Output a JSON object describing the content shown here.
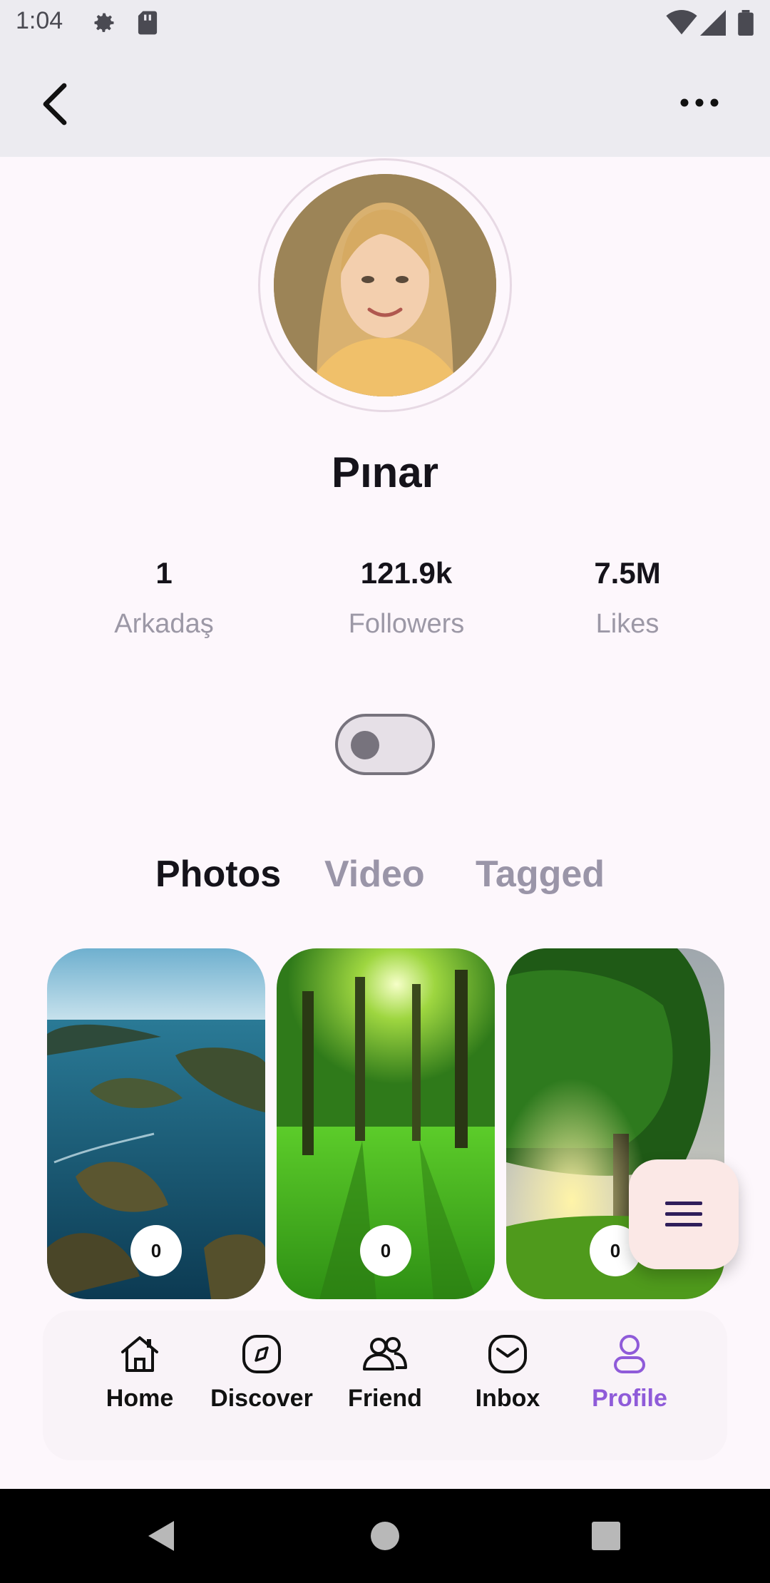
{
  "status_bar": {
    "time": "1:04",
    "icons": [
      "gear-icon",
      "sd-card-icon",
      "wifi-icon",
      "signal-icon",
      "battery-icon"
    ]
  },
  "app_bar": {
    "back_icon": "chevron-left-icon",
    "more_icon": "more-horizontal-icon"
  },
  "profile": {
    "name": "Pınar",
    "stats": [
      {
        "value": "1",
        "label": "Arkadaş"
      },
      {
        "value": "121.9k",
        "label": "Followers"
      },
      {
        "value": "7.5M",
        "label": "Likes"
      }
    ],
    "toggle_on": false
  },
  "tabs": [
    {
      "label": "Photos",
      "active": true
    },
    {
      "label": "Video",
      "active": false
    },
    {
      "label": "Tagged",
      "active": false
    }
  ],
  "photos": [
    {
      "count": "0",
      "scene": "archipelago"
    },
    {
      "count": "0",
      "scene": "green-park"
    },
    {
      "count": "0",
      "scene": "tree-sunset"
    }
  ],
  "fab": {
    "icon": "menu-icon"
  },
  "bottom_nav": [
    {
      "label": "Home",
      "icon": "home-icon",
      "active": false
    },
    {
      "label": "Discover",
      "icon": "compass-icon",
      "active": false
    },
    {
      "label": "Friend",
      "icon": "users-icon",
      "active": false
    },
    {
      "label": "Inbox",
      "icon": "inbox-icon",
      "active": false
    },
    {
      "label": "Profile",
      "icon": "user-icon",
      "active": true
    }
  ],
  "colors": {
    "accent": "#8f5bd9",
    "text": "#15131a",
    "muted": "#9c98a6",
    "inactive_tab": "#9a95a8",
    "fab_bg": "#fbe8e6",
    "fab_icon": "#2f1e5a"
  }
}
